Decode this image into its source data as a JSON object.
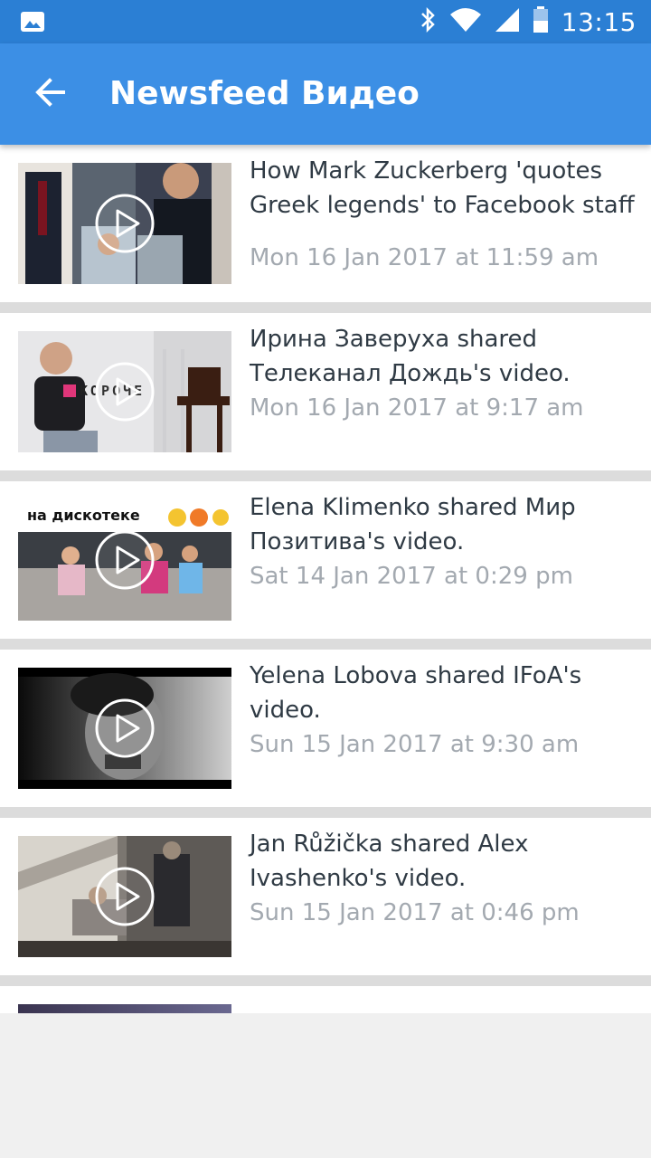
{
  "status_bar": {
    "time": "13:15",
    "icons": [
      "image-icon",
      "bluetooth-icon",
      "wifi-icon",
      "signal-icon",
      "battery-icon"
    ]
  },
  "app_bar": {
    "title": "Newsfeed Видео",
    "back_icon": "arrow-back-icon"
  },
  "colors": {
    "status_bar": "#2b7fd4",
    "app_bar": "#3c8fe5",
    "title_text": "#2f3a44",
    "date_text": "#a3a9b0",
    "divider": "#dcdcdc"
  },
  "feed": {
    "items": [
      {
        "title": "How Mark Zuckerberg 'quotes Greek legends' to Facebook staff",
        "date": "Mon 16 Jan 2017 at 11:59 am",
        "play_icon": "play-circle-icon"
      },
      {
        "title": "Ирина Заверуха shared Телеканал Дождь's video.",
        "date": "Mon 16 Jan 2017 at 9:17 am",
        "play_icon": "play-circle-icon",
        "thumb_text": "КОРОЧЕ"
      },
      {
        "title": "Elena Klimenko shared Мир Позитива's video.",
        "date": "Sat 14 Jan 2017 at 0:29 pm",
        "play_icon": "play-circle-icon",
        "thumb_text": "на дискотеке"
      },
      {
        "title": "Yelena Lobova shared IFoA's video.",
        "date": "Sun 15 Jan 2017 at 9:30 am",
        "play_icon": "play-circle-icon"
      },
      {
        "title": "Jan Růžička shared Alex Ivashenko's video.",
        "date": "Sun 15 Jan 2017 at 0:46 pm",
        "play_icon": "play-circle-icon"
      }
    ]
  }
}
